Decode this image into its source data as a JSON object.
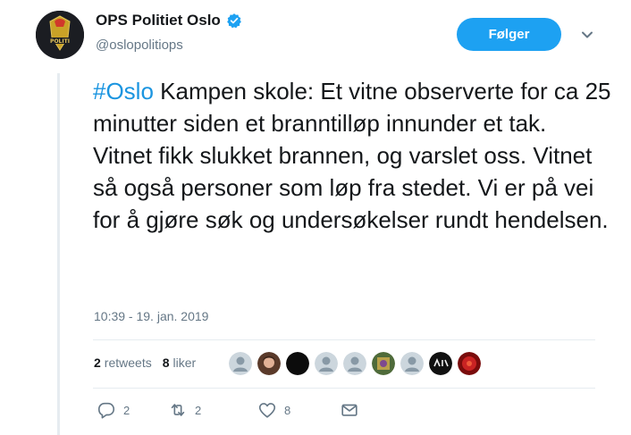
{
  "user": {
    "display_name": "OPS Politiet Oslo",
    "handle": "@oslopolitiops",
    "verified": true,
    "avatar_text": "POLITI"
  },
  "follow_button": {
    "label": "Følger"
  },
  "tweet": {
    "hashtag": "#Oslo",
    "text": " Kampen skole: Et vitne observerte for ca 25 minutter siden et branntilløp innunder et tak. Vitnet fikk slukket brannen, og varslet oss. Vitnet så også personer som løp fra stedet. Vi er på vei for å gjøre søk og undersøkelser rundt hendelsen.",
    "timestamp": "10:39 - 19. jan. 2019"
  },
  "stats": {
    "retweets_count": "2",
    "retweets_label": "retweets",
    "likes_count": "8",
    "likes_label": "liker"
  },
  "actions": {
    "reply_count": "2",
    "retweet_count": "2",
    "like_count": "8"
  },
  "colors": {
    "accent": "#1da1f2",
    "hashtag": "#1b95e0",
    "muted": "#657786",
    "divider": "#e6ecf0"
  }
}
